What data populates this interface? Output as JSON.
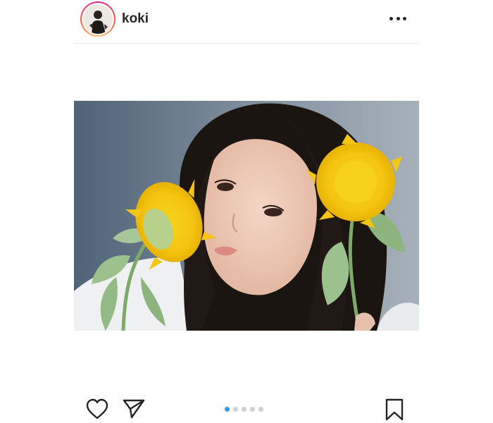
{
  "header": {
    "username": "koki",
    "more_icon": "more-horizontal-icon"
  },
  "post": {
    "photo_subject": "photo",
    "carousel": {
      "total": 5,
      "active": 1
    }
  },
  "actions": {
    "like_icon": "heart-icon",
    "share_icon": "paper-plane-icon",
    "save_icon": "bookmark-icon"
  },
  "colors": {
    "accent": "#3897f0",
    "text": "#262626"
  }
}
